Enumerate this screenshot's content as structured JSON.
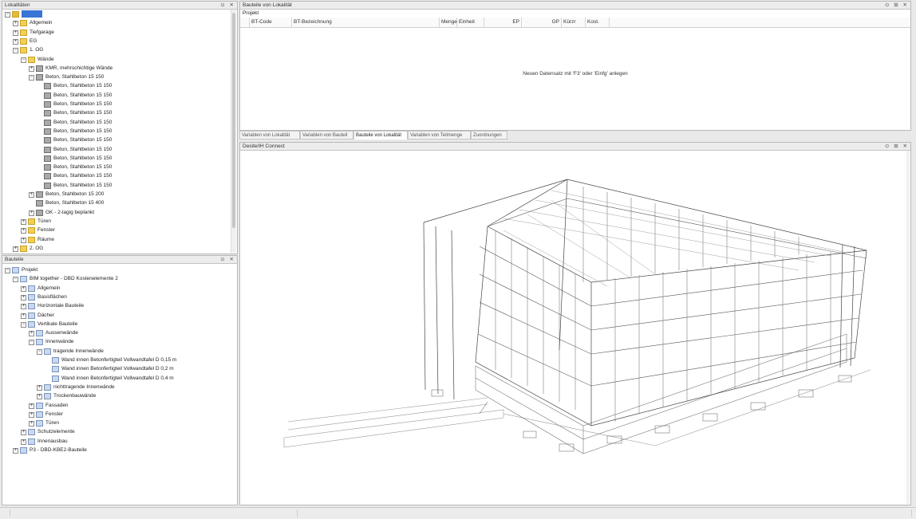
{
  "panels": {
    "lokalitaeten": {
      "title": "Lokalitäten",
      "buttons": "⊙ ✕"
    },
    "bauteile": {
      "title": "Bauteile",
      "buttons": "⊙ ✕"
    },
    "bauteile_von_lokalitaet": {
      "title": "Bauteile von Lokalität",
      "buttons": "⊙ ⊞ ✕"
    },
    "viewer": {
      "title": "Desite/IH Connect",
      "buttons": "⊙ ⊞ ✕"
    }
  },
  "lokal_tree": [
    {
      "label": "",
      "indent": 0,
      "expander": "−",
      "icon": "fold",
      "selected": true
    },
    {
      "label": "Allgemein",
      "indent": 1,
      "expander": "+",
      "icon": "fold"
    },
    {
      "label": "Tiefgarage",
      "indent": 1,
      "expander": "+",
      "icon": "fold"
    },
    {
      "label": "EG",
      "indent": 1,
      "expander": "+",
      "icon": "fold"
    },
    {
      "label": "1. OG",
      "indent": 1,
      "expander": "−",
      "icon": "fold"
    },
    {
      "label": "Wände",
      "indent": 2,
      "expander": "−",
      "icon": "fold"
    },
    {
      "label": "KMR, mehrschichtige Wände",
      "indent": 3,
      "expander": "+",
      "icon": "wall"
    },
    {
      "label": "Beton, Stahlbeton 15 150",
      "indent": 3,
      "expander": "−",
      "icon": "wall"
    },
    {
      "label": "Beton, Stahlbeton 15 150",
      "indent": 4,
      "expander": "",
      "icon": "wall"
    },
    {
      "label": "Beton, Stahlbeton 15 150",
      "indent": 4,
      "expander": "",
      "icon": "wall"
    },
    {
      "label": "Beton, Stahlbeton 15 150",
      "indent": 4,
      "expander": "",
      "icon": "wall"
    },
    {
      "label": "Beton, Stahlbeton 15 150",
      "indent": 4,
      "expander": "",
      "icon": "wall"
    },
    {
      "label": "Beton, Stahlbeton 15 150",
      "indent": 4,
      "expander": "",
      "icon": "wall"
    },
    {
      "label": "Beton, Stahlbeton 15 150",
      "indent": 4,
      "expander": "",
      "icon": "wall"
    },
    {
      "label": "Beton, Stahlbeton 15 150",
      "indent": 4,
      "expander": "",
      "icon": "wall"
    },
    {
      "label": "Beton, Stahlbeton 15 150",
      "indent": 4,
      "expander": "",
      "icon": "wall"
    },
    {
      "label": "Beton, Stahlbeton 15 150",
      "indent": 4,
      "expander": "",
      "icon": "wall"
    },
    {
      "label": "Beton, Stahlbeton 15 150",
      "indent": 4,
      "expander": "",
      "icon": "wall"
    },
    {
      "label": "Beton, Stahlbeton 15 150",
      "indent": 4,
      "expander": "",
      "icon": "wall"
    },
    {
      "label": "Beton, Stahlbeton 15 150",
      "indent": 4,
      "expander": "",
      "icon": "wall"
    },
    {
      "label": "Beton, Stahlbeton 15 200",
      "indent": 3,
      "expander": "+",
      "icon": "wall"
    },
    {
      "label": "Beton, Stahlbeton 15 400",
      "indent": 3,
      "expander": "",
      "icon": "wall"
    },
    {
      "label": "GK - 2-lagig beplankt",
      "indent": 3,
      "expander": "+",
      "icon": "wall"
    },
    {
      "label": "Türen",
      "indent": 2,
      "expander": "+",
      "icon": "fold"
    },
    {
      "label": "Fenster",
      "indent": 2,
      "expander": "+",
      "icon": "fold"
    },
    {
      "label": "Räume",
      "indent": 2,
      "expander": "+",
      "icon": "fold"
    },
    {
      "label": "2. OG",
      "indent": 1,
      "expander": "+",
      "icon": "fold"
    }
  ],
  "bauteile_tree": [
    {
      "label": "Projekt",
      "indent": 0,
      "expander": "−",
      "icon": "bt"
    },
    {
      "label": "BIM together - DBD Kostenelemente 2",
      "indent": 1,
      "expander": "−",
      "icon": "bt"
    },
    {
      "label": "Allgemein",
      "indent": 2,
      "expander": "+",
      "icon": "bt"
    },
    {
      "label": "Basisflächen",
      "indent": 2,
      "expander": "+",
      "icon": "bt"
    },
    {
      "label": "Horizontale Bauteile",
      "indent": 2,
      "expander": "+",
      "icon": "bt"
    },
    {
      "label": "Dächer",
      "indent": 2,
      "expander": "+",
      "icon": "bt"
    },
    {
      "label": "Vertikale Bauteile",
      "indent": 2,
      "expander": "−",
      "icon": "bt"
    },
    {
      "label": "Aussenwände",
      "indent": 3,
      "expander": "+",
      "icon": "bt"
    },
    {
      "label": "Innenwände",
      "indent": 3,
      "expander": "−",
      "icon": "bt"
    },
    {
      "label": "tragende Innenwände",
      "indent": 4,
      "expander": "−",
      "icon": "bt"
    },
    {
      "label": "Wand innen Betonfertigteil Vollwandtafel D 0,15 m",
      "indent": 5,
      "expander": "",
      "icon": "bt"
    },
    {
      "label": "Wand innen Betonfertigteil Vollwandtafel D 0,2 m",
      "indent": 5,
      "expander": "",
      "icon": "bt"
    },
    {
      "label": "Wand innen Betonfertigteil Vollwandtafel D 0,4 m",
      "indent": 5,
      "expander": "",
      "icon": "bt"
    },
    {
      "label": "nichttragende Innenwände",
      "indent": 4,
      "expander": "+",
      "icon": "bt"
    },
    {
      "label": "Trockenbauwände",
      "indent": 4,
      "expander": "+",
      "icon": "bt"
    },
    {
      "label": "Fassaden",
      "indent": 3,
      "expander": "+",
      "icon": "bt"
    },
    {
      "label": "Fenster",
      "indent": 3,
      "expander": "+",
      "icon": "bt"
    },
    {
      "label": "Türen",
      "indent": 3,
      "expander": "+",
      "icon": "bt"
    },
    {
      "label": "Schutzelemente",
      "indent": 2,
      "expander": "+",
      "icon": "bt"
    },
    {
      "label": "Innenausbau",
      "indent": 2,
      "expander": "+",
      "icon": "bt"
    },
    {
      "label": "P3 - DBD-KBE2-Bauteile",
      "indent": 1,
      "expander": "+",
      "icon": "bt"
    }
  ],
  "table": {
    "group_label": "Projekt",
    "columns": [
      "",
      "BT-Code",
      "BT-Bezeichnung",
      "Menge",
      "Einheit",
      "EP",
      "GP",
      "Kürzr",
      "Kost."
    ],
    "empty_message": "Neuen Datensatz mit 'F3' oder 'Einfg' anlegen"
  },
  "tabs": [
    {
      "label": "Variablen von Lokalität",
      "active": false
    },
    {
      "label": "Variablen von Bauteil",
      "active": false
    },
    {
      "label": "Bauteile von Lokalität",
      "active": true
    },
    {
      "label": "Variablen von Teilmenge",
      "active": false
    },
    {
      "label": "Zuordnungen",
      "active": false
    }
  ]
}
